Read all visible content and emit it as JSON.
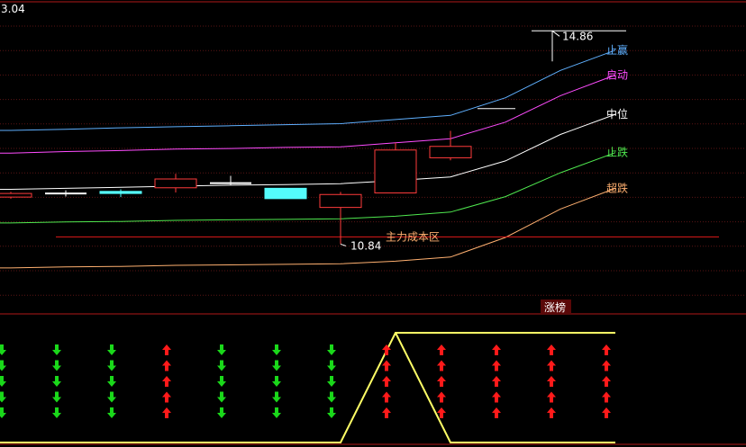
{
  "top_left_value": "3.04",
  "chart_data": [
    {
      "type": "candlestick",
      "title": "",
      "ylim": [
        9.5,
        15.3
      ],
      "grid": "dotted-horizontal",
      "candles": [
        {
          "open": 11.75,
          "close": 11.82,
          "high": 11.85,
          "low": 11.72
        },
        {
          "open": 11.82,
          "close": 11.82,
          "high": 11.88,
          "low": 11.76
        },
        {
          "open": 11.86,
          "close": 11.82,
          "high": 11.9,
          "low": 11.75
        },
        {
          "open": 11.93,
          "close": 12.1,
          "high": 12.2,
          "low": 11.84
        },
        {
          "open": 12.02,
          "close": 12.02,
          "high": 12.16,
          "low": 11.98
        },
        {
          "open": 11.92,
          "close": 11.72,
          "high": 11.92,
          "low": 11.72
        },
        {
          "open": 11.55,
          "close": 11.8,
          "high": 11.85,
          "low": 10.84
        },
        {
          "open": 11.83,
          "close": 12.66,
          "high": 12.8,
          "low": 11.83
        },
        {
          "open": 12.51,
          "close": 12.73,
          "high": 13.03,
          "low": 12.46
        }
      ],
      "candle_colors": {
        "up": "#ff3b3b",
        "down": "#54fcfc",
        "neutral": "#ffffff"
      },
      "bands": [
        {
          "name": "止赢",
          "color": "#5fb0ff",
          "values": [
            13.04,
            13.06,
            13.09,
            13.11,
            13.13,
            13.15,
            13.17,
            13.25,
            13.33,
            13.67,
            14.2,
            14.59
          ]
        },
        {
          "name": "启动",
          "color": "#ff4cff",
          "values": [
            12.6,
            12.63,
            12.65,
            12.68,
            12.69,
            12.71,
            12.72,
            12.8,
            12.88,
            13.2,
            13.71,
            14.11
          ]
        },
        {
          "name": "中位",
          "color": "#ffffff",
          "values": [
            11.9,
            11.92,
            11.94,
            11.96,
            11.98,
            11.99,
            12.01,
            12.07,
            12.14,
            12.45,
            12.96,
            13.35
          ]
        },
        {
          "name": "止跌",
          "color": "#4fe84f",
          "values": [
            11.25,
            11.27,
            11.28,
            11.3,
            11.31,
            11.32,
            11.33,
            11.38,
            11.46,
            11.76,
            12.22,
            12.61
          ]
        },
        {
          "name": "超跌",
          "color": "#ffb070",
          "values": [
            10.38,
            10.4,
            10.41,
            10.43,
            10.44,
            10.45,
            10.46,
            10.51,
            10.59,
            10.97,
            11.52,
            11.92
          ]
        }
      ],
      "cost_line": {
        "label": "主力成本区",
        "value": 10.98,
        "color": "#e01a1a"
      },
      "low_marker": {
        "label": "10.84",
        "value": 10.84,
        "candle": 6
      },
      "high_marker": {
        "label": "14.86",
        "value": 14.86
      },
      "white_tick": {
        "value": 13.46
      }
    },
    {
      "type": "signal",
      "badge": "涨榜",
      "signals": [
        "down",
        "down",
        "down",
        "up",
        "down",
        "down",
        "down",
        "up",
        "up",
        "up",
        "up",
        "up"
      ],
      "arrow_rows": 5,
      "arrow_colors": {
        "up": "#ff1a1a",
        "down": "#1ad81a"
      },
      "line_color": "#ffff66",
      "line": [
        0,
        0,
        0,
        0,
        0,
        0,
        0,
        1,
        0,
        0,
        0,
        0
      ],
      "line_extension": "flat at top after peak"
    }
  ]
}
